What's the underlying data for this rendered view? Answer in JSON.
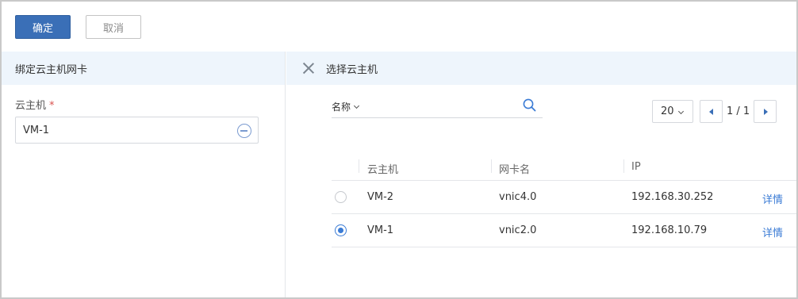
{
  "toolbar": {
    "confirm_label": "确定",
    "cancel_label": "取消"
  },
  "left_panel": {
    "title": "绑定云主机网卡",
    "field_label": "云主机",
    "required_mark": "*",
    "field_value": "VM-1"
  },
  "right_panel": {
    "title": "选择云主机",
    "search": {
      "field": "名称",
      "value": ""
    },
    "pagination": {
      "page_size": "20",
      "page_info": "1 / 1"
    },
    "table": {
      "columns": [
        "云主机",
        "网卡名",
        "IP"
      ],
      "rows": [
        {
          "vm": "VM-2",
          "nic": "vnic4.0",
          "ip": "192.168.30.252",
          "action": "详情",
          "selected": false
        },
        {
          "vm": "VM-1",
          "nic": "vnic2.0",
          "ip": "192.168.10.79",
          "action": "详情",
          "selected": true
        }
      ]
    }
  },
  "colors": {
    "primary": "#3a6fb7",
    "header_bg": "#eef5fc",
    "link": "#3a7bd5"
  }
}
